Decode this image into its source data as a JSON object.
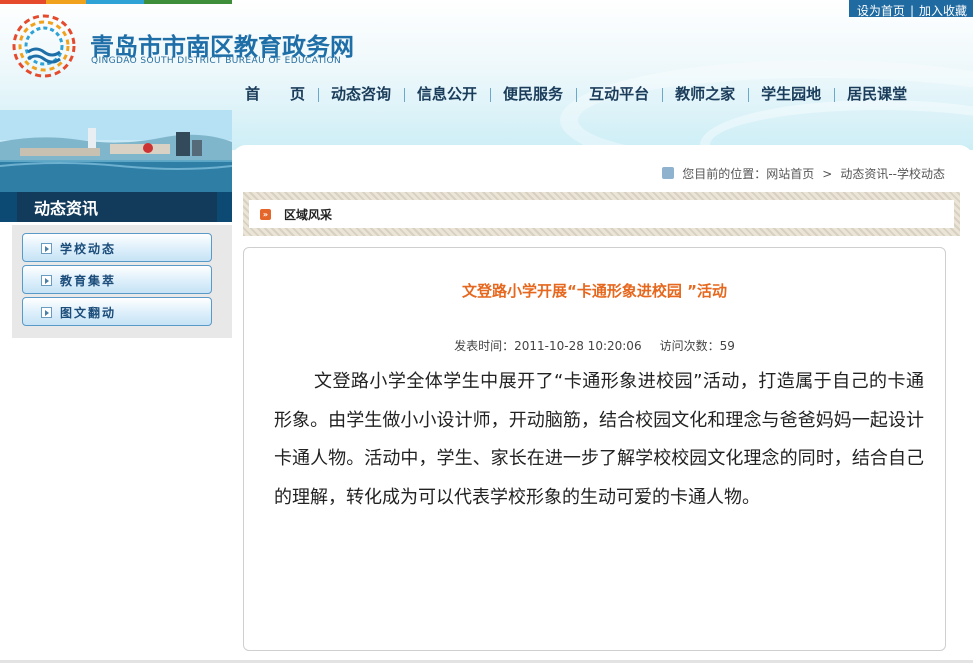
{
  "header": {
    "site_title": "青岛市市南区教育政务网",
    "site_subtitle": "QINGDAO SOUTH DISTRICT BUREAU OF EDUCATION",
    "top_links": [
      "设为首页",
      "加入收藏"
    ],
    "top_link_separator": "|"
  },
  "nav": {
    "items": [
      "首　　页",
      "动态咨询",
      "信息公开",
      "便民服务",
      "互动平台",
      "教师之家",
      "学生园地",
      "居民课堂"
    ]
  },
  "sidebar": {
    "section_title": "动态资讯",
    "items": [
      "学校动态",
      "教育集萃",
      "图文翻动"
    ]
  },
  "breadcrumb": {
    "prefix": "您目前的位置：网站首页",
    "arrow": ">",
    "current": "动态资讯--学校动态"
  },
  "section": {
    "label": "区域风采"
  },
  "article": {
    "title": "文登路小学开展“卡通形象进校园 ”活动",
    "publish_time": "发表时间：2011-10-28 10:20:06",
    "views": "访问次数：59",
    "body": "文登路小学全体学生中展开了“卡通形象进校园”活动，打造属于自己的卡通形象。由学生做小小设计师，开动脑筋，结合校园文化和理念与爸爸妈妈一起设计卡通人物。活动中，学生、家长在进一步了解学校校园文化理念的同时，结合自己的理解，转化成为可以代表学校形象的生动可爱的卡通人物。"
  },
  "colors": {
    "nav_text": "#1a3c5a",
    "brand_blue": "#1e6ea8",
    "title_orange": "#e6681e",
    "section_dark": "#0d4a73"
  }
}
